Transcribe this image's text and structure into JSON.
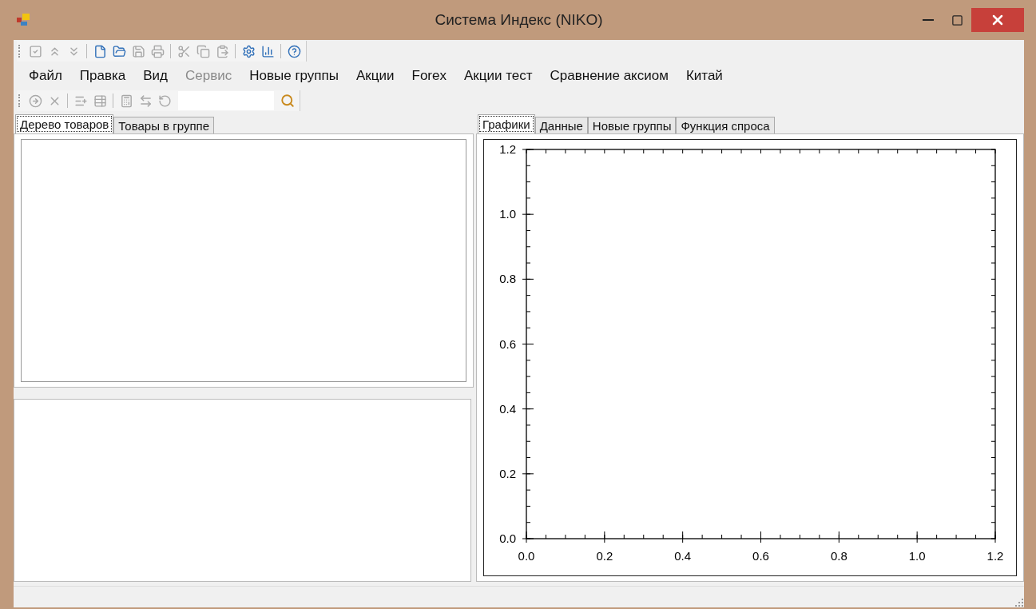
{
  "window": {
    "title": "Система Индекс (NIKO)"
  },
  "toolbar_1": {
    "groups": [
      [
        {
          "disabled": true
        },
        {
          "disabled": true
        },
        {
          "disabled": true
        }
      ],
      [
        {
          "disabled": false
        },
        {
          "disabled": false
        },
        {
          "disabled": true
        },
        {
          "disabled": true
        }
      ],
      [
        {
          "disabled": true
        },
        {
          "disabled": true
        },
        {
          "disabled": true
        }
      ],
      [
        {
          "disabled": false
        },
        {
          "disabled": false
        }
      ],
      [
        {
          "disabled": false
        }
      ]
    ]
  },
  "menu": [
    {
      "label": "Файл",
      "disabled": false
    },
    {
      "label": "Правка",
      "disabled": false
    },
    {
      "label": "Вид",
      "disabled": false
    },
    {
      "label": "Сервис",
      "disabled": true
    },
    {
      "label": "Новые группы",
      "disabled": false
    },
    {
      "label": "Акции",
      "disabled": false
    },
    {
      "label": "Forex",
      "disabled": false
    },
    {
      "label": "Акции тест",
      "disabled": false
    },
    {
      "label": "Сравнение аксиом",
      "disabled": false
    },
    {
      "label": "Китай",
      "disabled": false
    }
  ],
  "toolbar_2": {
    "groups": [
      [
        {
          "disabled": true
        },
        {
          "disabled": true
        }
      ],
      [
        {
          "disabled": true
        },
        {
          "disabled": true
        }
      ],
      [
        {
          "disabled": true
        },
        {
          "disabled": true
        },
        {
          "disabled": true
        }
      ]
    ],
    "search": {
      "disabled": false
    }
  },
  "left_tabs": [
    {
      "label": "Дерево товаров",
      "selected": true
    },
    {
      "label": "Товары в группе",
      "selected": false
    }
  ],
  "right_tabs": [
    {
      "label": "Графики",
      "selected": true
    },
    {
      "label": "Данные",
      "selected": false
    },
    {
      "label": "Новые группы",
      "selected": false
    },
    {
      "label": "Функция спроса",
      "selected": false
    }
  ],
  "chart": {
    "chart_data": {
      "type": "line",
      "xlim": [
        0,
        1.2
      ],
      "ylim": [
        0,
        1.2
      ],
      "xticks": [
        {
          "value": 0,
          "label": "0.0"
        },
        {
          "value": 0.2,
          "label": "0.2"
        },
        {
          "value": 0.4,
          "label": "0.4"
        },
        {
          "value": 0.6,
          "label": "0.6"
        },
        {
          "value": 0.8,
          "label": "0.8"
        },
        {
          "value": 1.0,
          "label": "1.0"
        },
        {
          "value": 1.2,
          "label": "1.2"
        }
      ],
      "yticks": [
        {
          "value": 0,
          "label": "0.0"
        },
        {
          "value": 0.2,
          "label": "0.2"
        },
        {
          "value": 0.4,
          "label": "0.4"
        },
        {
          "value": 0.6,
          "label": "0.6"
        },
        {
          "value": 0.8,
          "label": "0.8"
        },
        {
          "value": 1.0,
          "label": "1.0"
        },
        {
          "value": 1.2,
          "label": "1.2"
        }
      ]
    }
  }
}
